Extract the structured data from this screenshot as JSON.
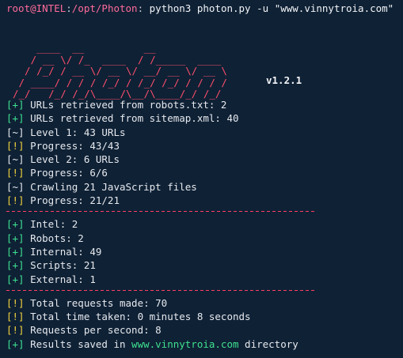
{
  "prompt": {
    "user_host": "root@INTEL",
    "separator": ":",
    "path": "/opt/Photon",
    "separator2": ":",
    "command": " python3 photon.py -u \"www.vinnytroia.com\""
  },
  "banner": {
    "art": "    ____  __          __\n   / __ \\/ /_  ____  / /_____  ____\n  / /_/ / __ \\/ __ \\/ __/ __ \\/ __ \\\n / ____/ / / / /_/ / /_/ /_/ / / / /\n/_/   /_/ /_/\\____/\\__/\\____/_/ /_/",
    "version": "v1.2.1"
  },
  "colors": {
    "background": "#0f2135",
    "plus_tag": "#3ee08f",
    "bang_tag": "#f2d23e",
    "banner": "#ff4f6d",
    "divider": "#ff3f66"
  },
  "crawl_log": [
    {
      "tag": "[+]",
      "kind": "plus",
      "text": " URLs retrieved from robots.txt: 2"
    },
    {
      "tag": "[+]",
      "kind": "plus",
      "text": " URLs retrieved from sitemap.xml: 40"
    },
    {
      "tag": "[~]",
      "kind": "tilde",
      "text": " Level 1: 43 URLs"
    },
    {
      "tag": "[!]",
      "kind": "bang",
      "text": " Progress: 43/43"
    },
    {
      "tag": "[~]",
      "kind": "tilde",
      "text": " Level 2: 6 URLs"
    },
    {
      "tag": "[!]",
      "kind": "bang",
      "text": " Progress: 6/6"
    },
    {
      "tag": "[~]",
      "kind": "tilde",
      "text": " Crawling 21 JavaScript files"
    },
    {
      "tag": "[!]",
      "kind": "bang",
      "text": " Progress: 21/21"
    }
  ],
  "results": [
    {
      "tag": "[+]",
      "kind": "plus",
      "text": " Intel: 2"
    },
    {
      "tag": "[+]",
      "kind": "plus",
      "text": " Robots: 2"
    },
    {
      "tag": "[+]",
      "kind": "plus",
      "text": " Internal: 49"
    },
    {
      "tag": "[+]",
      "kind": "plus",
      "text": " Scripts: 21"
    },
    {
      "tag": "[+]",
      "kind": "plus",
      "text": " External: 1"
    }
  ],
  "summary": {
    "requests": {
      "tag": "[!]",
      "text": " Total requests made: 70"
    },
    "time": {
      "tag": "[!]",
      "text": " Total time taken: 0 minutes 8 seconds"
    },
    "rate": {
      "tag": "[!]",
      "text": " Requests per second: 8"
    },
    "saved": {
      "tag": "[+]",
      "prefix": " Results saved in ",
      "link": "www.vinnytroia.com",
      "suffix": " directory"
    }
  }
}
